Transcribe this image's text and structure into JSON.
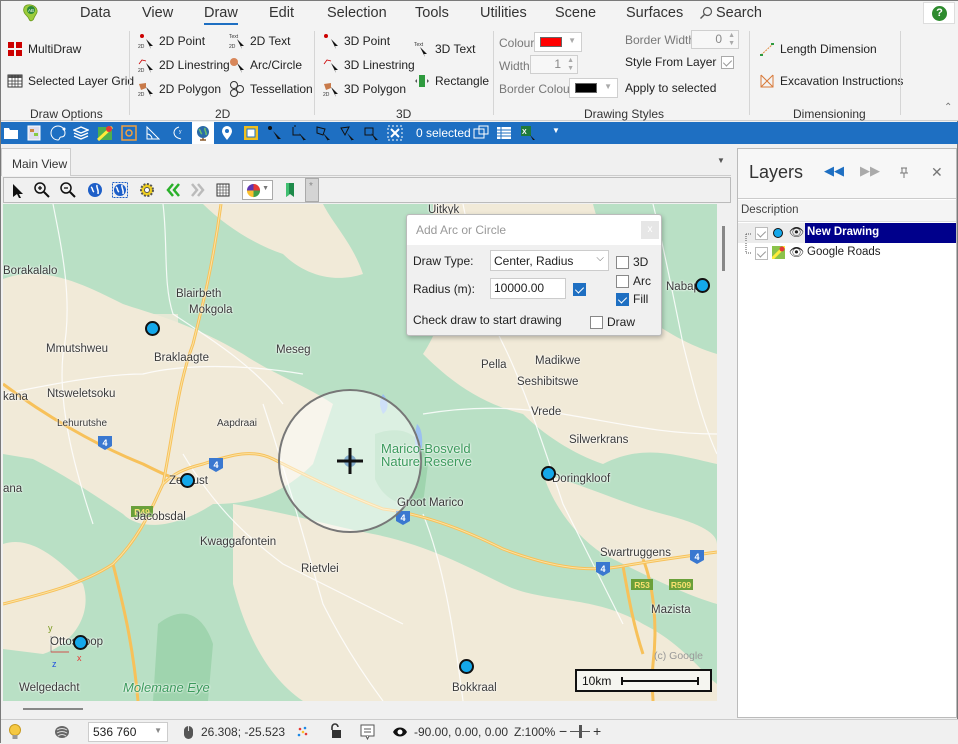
{
  "menubar": {
    "tabs": [
      "Data",
      "View",
      "Draw",
      "Edit",
      "Selection",
      "Tools",
      "Utilities",
      "Scene",
      "Surfaces"
    ],
    "active_tab": "Draw",
    "search_label": "Search",
    "help_label": "?"
  },
  "ribbon": {
    "draw_options": {
      "label": "Draw Options",
      "items": [
        "MultiDraw",
        "Selected Layer Grid"
      ]
    },
    "group_2d": {
      "label": "2D",
      "items": [
        "2D Point",
        "2D Linestring",
        "2D Polygon",
        "2D Text",
        "Arc/Circle",
        "Tessellation"
      ]
    },
    "group_3d": {
      "label": "3D",
      "items": [
        "3D Point",
        "3D Linestring",
        "3D Polygon",
        "3D Text",
        "Rectangle"
      ]
    },
    "drawing_styles": {
      "label": "Drawing Styles",
      "colour_label": "Colour",
      "colour_value": "#ff0000",
      "width_label": "Width",
      "width_value": "1",
      "border_colour_label": "Border Colour",
      "border_colour_value": "#000000",
      "border_width_label": "Border Width",
      "border_width_value": "0",
      "style_from_layer_label": "Style From Layer",
      "style_from_layer_checked": true,
      "apply_to_selected_label": "Apply to selected"
    },
    "dimensioning": {
      "label": "Dimensioning",
      "items": [
        "Length Dimension",
        "Excavation Instructions"
      ]
    }
  },
  "bluebar": {
    "selected_count": "0 selected"
  },
  "view_tabs": {
    "tabs": [
      "Main View"
    ],
    "active": "Main View"
  },
  "map_toolbar": {
    "status_label": "*"
  },
  "map": {
    "places": [
      {
        "name": "Uitkyk"
      },
      {
        "name": "Borakalalo"
      },
      {
        "name": "Blairbeth"
      },
      {
        "name": "Mokgola"
      },
      {
        "name": "Mmutshweu"
      },
      {
        "name": "Braklaagte"
      },
      {
        "name": "Meseg"
      },
      {
        "name": "Ntsweletsoku"
      },
      {
        "name": "kana"
      },
      {
        "name": "Lehurutshe"
      },
      {
        "name": "Aapdraai"
      },
      {
        "name": "Zeerust"
      },
      {
        "name": "ana"
      },
      {
        "name": "Jacobsdal"
      },
      {
        "name": "Kwaggafontein"
      },
      {
        "name": "Rietvlei"
      },
      {
        "name": "Ottoshoop"
      },
      {
        "name": "Welgedacht"
      },
      {
        "name": "Molemane Eye"
      },
      {
        "name": "Pella"
      },
      {
        "name": "Madikwe"
      },
      {
        "name": "Seshibitswe"
      },
      {
        "name": "Vrede"
      },
      {
        "name": "Silwerkrans"
      },
      {
        "name": "Doringkloof"
      },
      {
        "name": "Groot Marico"
      },
      {
        "name": "Swartruggens"
      },
      {
        "name": "Mazista"
      },
      {
        "name": "Bokkraal"
      },
      {
        "name": "Nabapa"
      },
      {
        "name": "Marico-Bosveld"
      },
      {
        "name": "Nature Reserve"
      }
    ],
    "road_shields": [
      "4",
      "4",
      "4",
      "4",
      "4",
      "R49",
      "R53",
      "R509"
    ],
    "attribution": "(c) Google",
    "scale_label": "10km",
    "axis_labels": {
      "x": "x",
      "y": "y",
      "z": "z"
    },
    "marker_color": "#14a8ea"
  },
  "dialog": {
    "title": "Add Arc or Circle",
    "close_label": "x",
    "draw_type_label": "Draw Type:",
    "draw_type_value": "Center, Radius",
    "radius_label": "Radius (m):",
    "radius_value": "10000.00",
    "radius_checked": true,
    "hint": "Check draw to start drawing",
    "options": [
      {
        "label": "3D",
        "checked": false
      },
      {
        "label": "Arc",
        "checked": false
      },
      {
        "label": "Fill",
        "checked": true
      }
    ],
    "draw_label": "Draw",
    "draw_checked": false
  },
  "layers": {
    "title": "Layers",
    "column_header": "Description",
    "items": [
      {
        "name": "New Drawing",
        "visible": true,
        "selected": true
      },
      {
        "name": "Google Roads",
        "visible": true,
        "selected": false
      }
    ]
  },
  "statusbar": {
    "scale_value": "536 760",
    "cursor_coords": "26.308; -25.523",
    "view_angles": "-90.00, 0.00, 0.00",
    "zoom": "Z:100%",
    "zoom_minus": "−",
    "zoom_plus": "+"
  }
}
